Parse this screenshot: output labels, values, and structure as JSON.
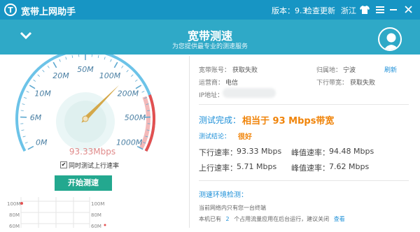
{
  "titlebar": {
    "logo_glyph": "T",
    "app_title": "宽带上网助手",
    "version_label": "版本：9.3",
    "check_update": "检查更新",
    "region": "浙江",
    "icons": [
      "shirt-icon",
      "menu-icon",
      "minimize-icon",
      "close-icon"
    ]
  },
  "header": {
    "title": "宽带测速",
    "subtitle": "为您提供最专业的测速服务",
    "collapse_icon": "chevron-down-icon"
  },
  "gauge": {
    "ticks": [
      "0M",
      "6M",
      "10M",
      "20M",
      "50M",
      "100M",
      "200M",
      "500M",
      "1000M"
    ],
    "reading": "93.33Mbps",
    "needle_fraction": 0.69,
    "colors": {
      "arc": "#6cc3e8",
      "danger": "#e35050",
      "needle": "#d4a84a"
    }
  },
  "controls": {
    "simultaneous_upload_label": "同时测试上行速率",
    "simultaneous_upload_checked": true,
    "start_button": "开始测速"
  },
  "mini_chart": {
    "y_ticks_left": [
      "100M",
      "80M",
      "60M"
    ],
    "y_ticks_right": [
      "100M",
      "80M",
      "60M"
    ]
  },
  "account": {
    "account_label": "宽带账号：",
    "account_value": "获取失败",
    "location_label": "归属地：",
    "location_value": "宁波",
    "refresh": "刷新",
    "isp_label": "运营商：",
    "isp_value": "电信",
    "down_bw_label": "下行带宽：",
    "down_bw_value": "获取失败",
    "ip_label": "IP地址："
  },
  "result": {
    "done_label": "测试完成：",
    "done_value": "相当于 93 Mbps带宽",
    "conclusion_label": "测试结论：",
    "conclusion_value": "很好",
    "down_rate_label": "下行速率：",
    "down_rate_value": "93.33 Mbps",
    "peak_down_label": "峰值速率：",
    "peak_down_value": "94.48 Mbps",
    "up_rate_label": "上行速率：",
    "up_rate_value": "5.71 Mbps",
    "peak_up_label": "峰值速率：",
    "peak_up_value": "7.62 Mbps"
  },
  "environment": {
    "title": "测速环境检测：",
    "line1": "当前网络内只有您一台终端",
    "line2_prefix": "本机已有",
    "line2_count": "2",
    "line2_suffix": "个占用流量应用在后台运行，建议关闭",
    "view_link": "查看"
  }
}
